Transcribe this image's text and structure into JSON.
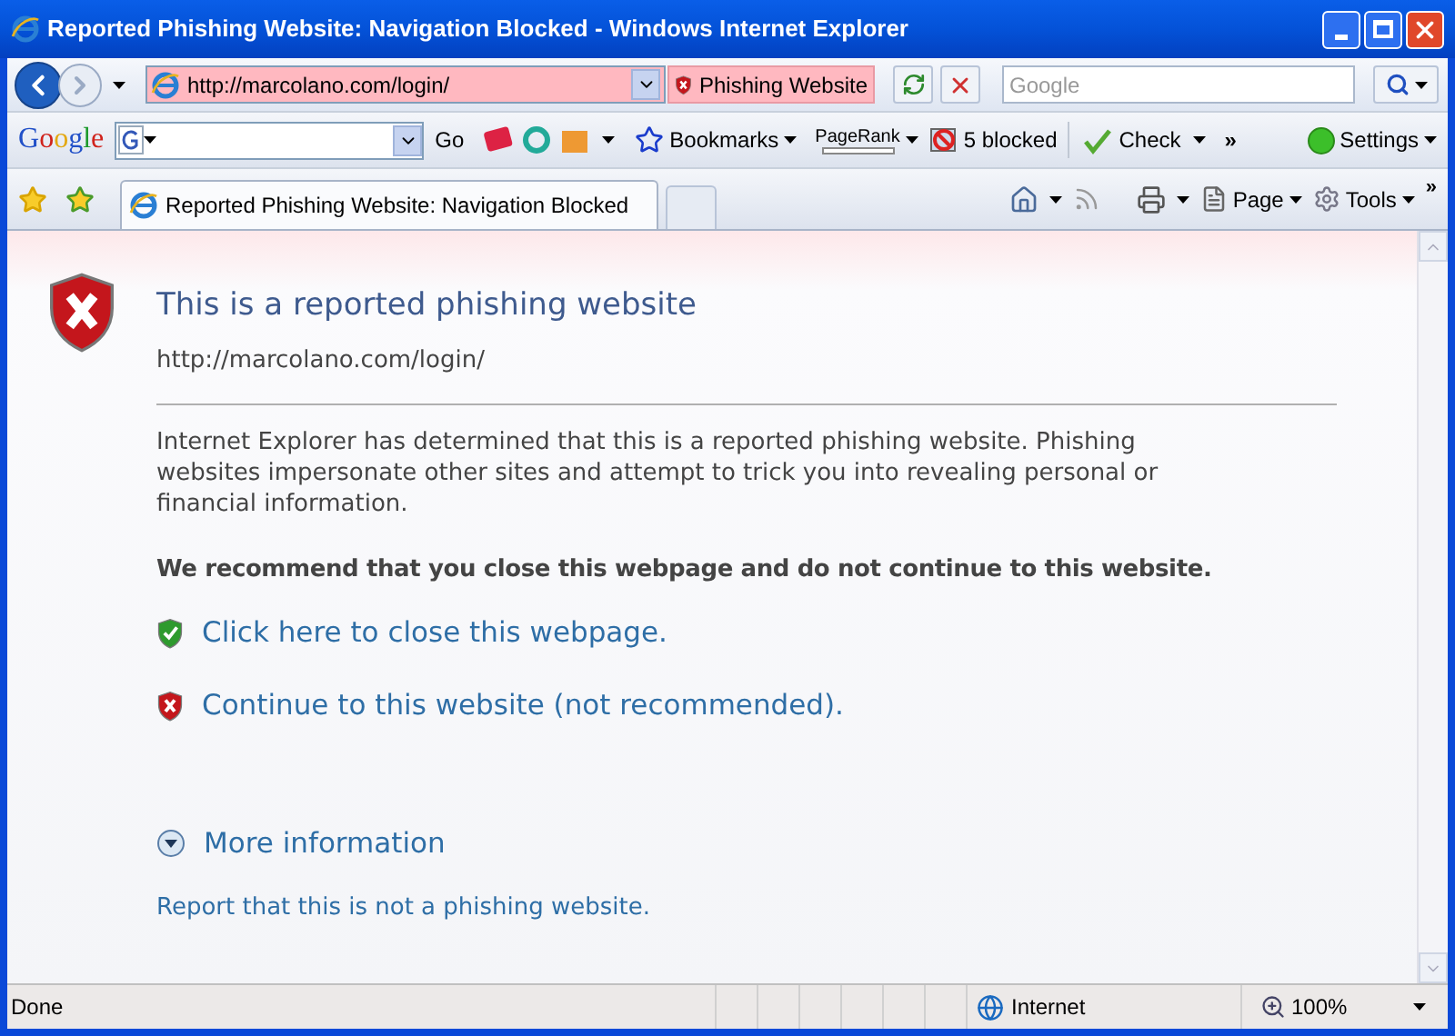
{
  "window": {
    "title": "Reported Phishing Website: Navigation Blocked - Windows Internet Explorer"
  },
  "address_bar": {
    "url": "http://marcolano.com/login/",
    "security_label": "Phishing Website"
  },
  "search": {
    "placeholder": "Google"
  },
  "google_toolbar": {
    "logo": "Google",
    "go": "Go",
    "bookmarks": "Bookmarks",
    "pagerank": "PageRank",
    "blocked": "5 blocked",
    "check": "Check",
    "more": "»",
    "settings": "Settings"
  },
  "tab": {
    "title": "Reported Phishing Website: Navigation Blocked"
  },
  "command_bar": {
    "page": "Page",
    "tools": "Tools",
    "more": "»"
  },
  "page": {
    "heading": "This is a reported phishing website",
    "url": "http://marcolano.com/login/",
    "description": "Internet Explorer has determined that this is a reported phishing website. Phishing websites impersonate other sites and attempt to trick you into revealing personal or financial information.",
    "recommendation": "We recommend that you close this webpage and do not continue to this website.",
    "links": [
      {
        "kind": "close",
        "text": "Click here to close this webpage."
      },
      {
        "kind": "continue",
        "text": "Continue to this website (not recommended)."
      }
    ],
    "more_info": "More information",
    "report": "Report that this is not a phishing website."
  },
  "status_bar": {
    "text": "Done",
    "zone": "Internet",
    "zoom": "100%"
  }
}
